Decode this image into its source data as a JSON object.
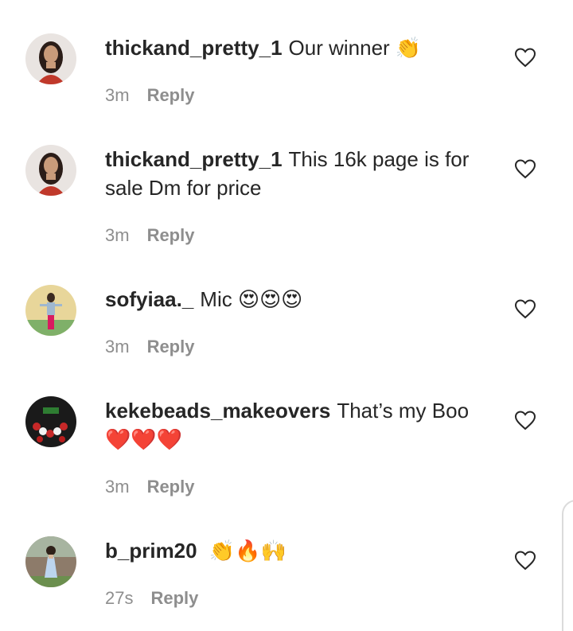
{
  "comments": [
    {
      "username": "thickand_pretty_1",
      "text": "Our winner",
      "emoji": "👏",
      "time": "3m",
      "reply_label": "Reply",
      "avatar_colors": {
        "bg": "#e9e4e1",
        "hair": "#2b1d18",
        "skin": "#c99b7a",
        "top": "#c0392b"
      }
    },
    {
      "username": "thickand_pretty_1",
      "text": "This 16k page is for sale Dm for price",
      "emoji": "",
      "time": "3m",
      "reply_label": "Reply",
      "avatar_colors": {
        "bg": "#e9e4e1",
        "hair": "#2b1d18",
        "skin": "#c99b7a",
        "top": "#c0392b"
      }
    },
    {
      "username": "sofyiaa._",
      "text": "Mic",
      "emoji": "😍😍😍",
      "time": "3m",
      "reply_label": "Reply",
      "avatar_colors": {
        "bg": "#e8d69a",
        "hair": "#3b2a20",
        "skin": "#9fb8cf",
        "top": "#d81b60"
      }
    },
    {
      "username": "kekebeads_makeovers",
      "text": "That’s my Boo",
      "emoji": "❤️❤️❤️",
      "time": "3m",
      "reply_label": "Reply",
      "avatar_colors": {
        "bg": "#1a1a1a",
        "hair": "#f2f2f2",
        "skin": "#c62828",
        "top": "#b71c1c"
      }
    },
    {
      "username": "b_prim20",
      "text": "",
      "emoji": "👏🔥🙌",
      "time": "27s",
      "reply_label": "Reply",
      "avatar_colors": {
        "bg": "#8d7b6a",
        "hair": "#2e2119",
        "skin": "#d9b89b",
        "top": "#bcd5ef"
      }
    }
  ],
  "colors": {
    "text": "#262626",
    "meta": "#8e8e8e",
    "heart_stroke": "#262626",
    "emoji_red": "#e53935"
  },
  "icons": {
    "like": "heart-outline-icon"
  }
}
